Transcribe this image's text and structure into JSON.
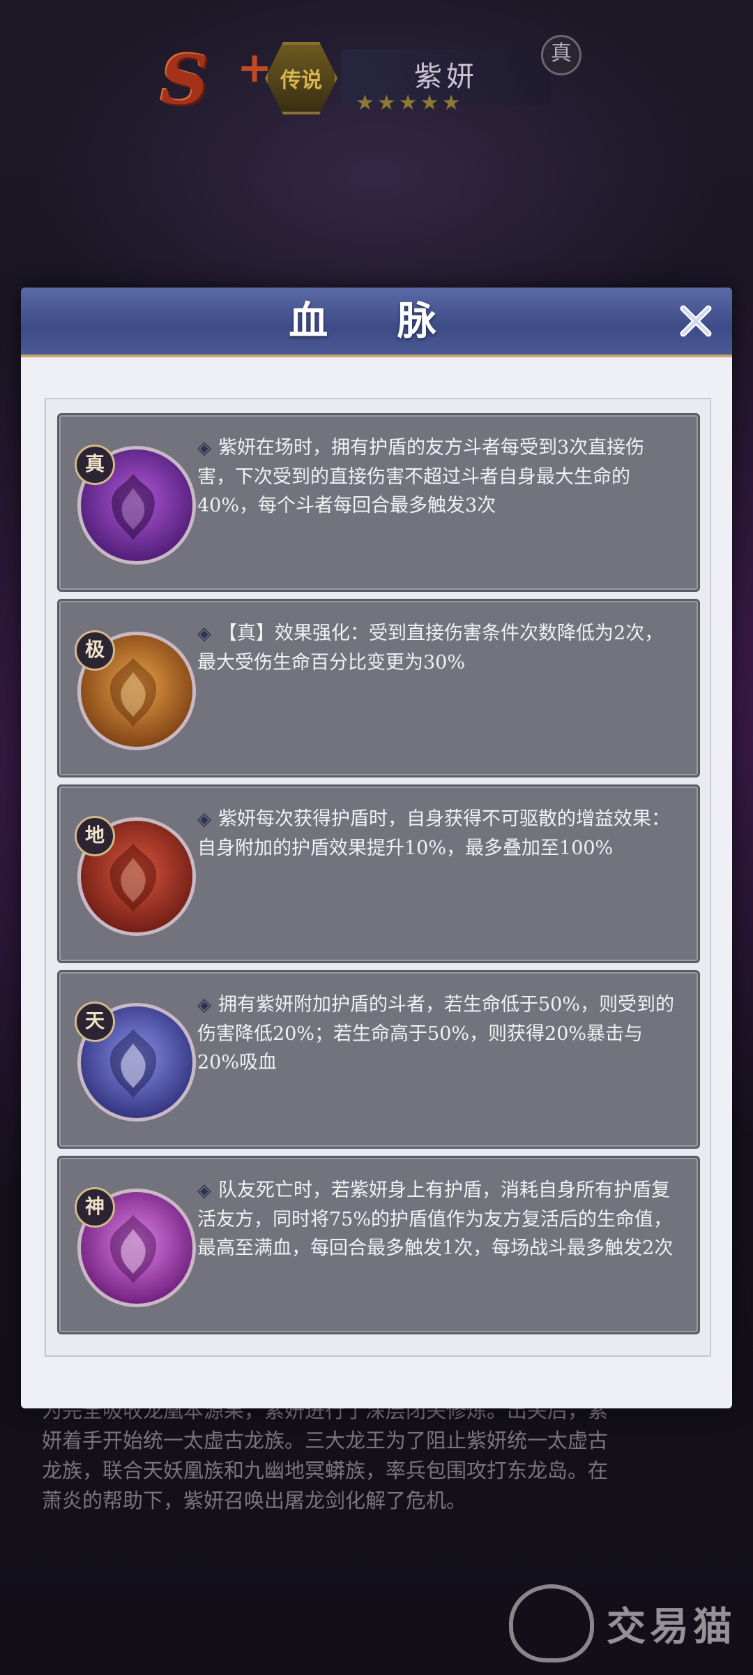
{
  "header": {
    "rank": "S",
    "rank_plus": "+",
    "rarity_badge": "传说",
    "hero_name": "紫妍",
    "true_badge": "真",
    "stars": "★★★★★"
  },
  "modal": {
    "title": "血 脉",
    "close_icon": "close-icon",
    "cards": [
      {
        "tag": "真",
        "text": "紫妍在场时，拥有护盾的友方斗者每受到3次直接伤害，下次受到的直接伤害不超过斗者自身最大生命的40%，每个斗者每回合最多触发3次",
        "color_a": "#b058d8",
        "color_b": "#4a1a72"
      },
      {
        "tag": "极",
        "text": "【真】效果强化：受到直接伤害条件次数降低为2次，最大受伤生命百分比变更为30%",
        "color_a": "#e8a24a",
        "color_b": "#7a3d10"
      },
      {
        "tag": "地",
        "text": "紫妍每次获得护盾时，自身获得不可驱散的增益效果：自身附加的护盾效果提升10%，最多叠加至100%",
        "color_a": "#d9563c",
        "color_b": "#6b1a14"
      },
      {
        "tag": "天",
        "text": "拥有紫妍附加护盾的斗者，若生命低于50%，则受到的伤害降低20%；若生命高于50%，则获得20%暴击与20%吸血",
        "color_a": "#8a8fe8",
        "color_b": "#2d2f7a"
      },
      {
        "tag": "神",
        "text": "队友死亡时，若紫妍身上有护盾，消耗自身所有护盾复活友方，同时将75%的护盾值作为友方复活后的生命值，最高至满血，每回合最多触发1次，每场战斗最多触发2次",
        "color_a": "#e080e8",
        "color_b": "#6a1a78"
      }
    ]
  },
  "background_story": [
    "为完全吸收龙凰本源果，紫妍进行了深层闭关修炼。出关后，紫",
    "妍着手开始统一太虚古龙族。三大龙王为了阻止紫妍统一太虚古",
    "龙族，联合天妖凰族和九幽地冥蟒族，率兵包围攻打东龙岛。在",
    "萧炎的帮助下，紫妍召唤出屠龙剑化解了危机。"
  ],
  "watermark": {
    "text": "交易猫"
  }
}
